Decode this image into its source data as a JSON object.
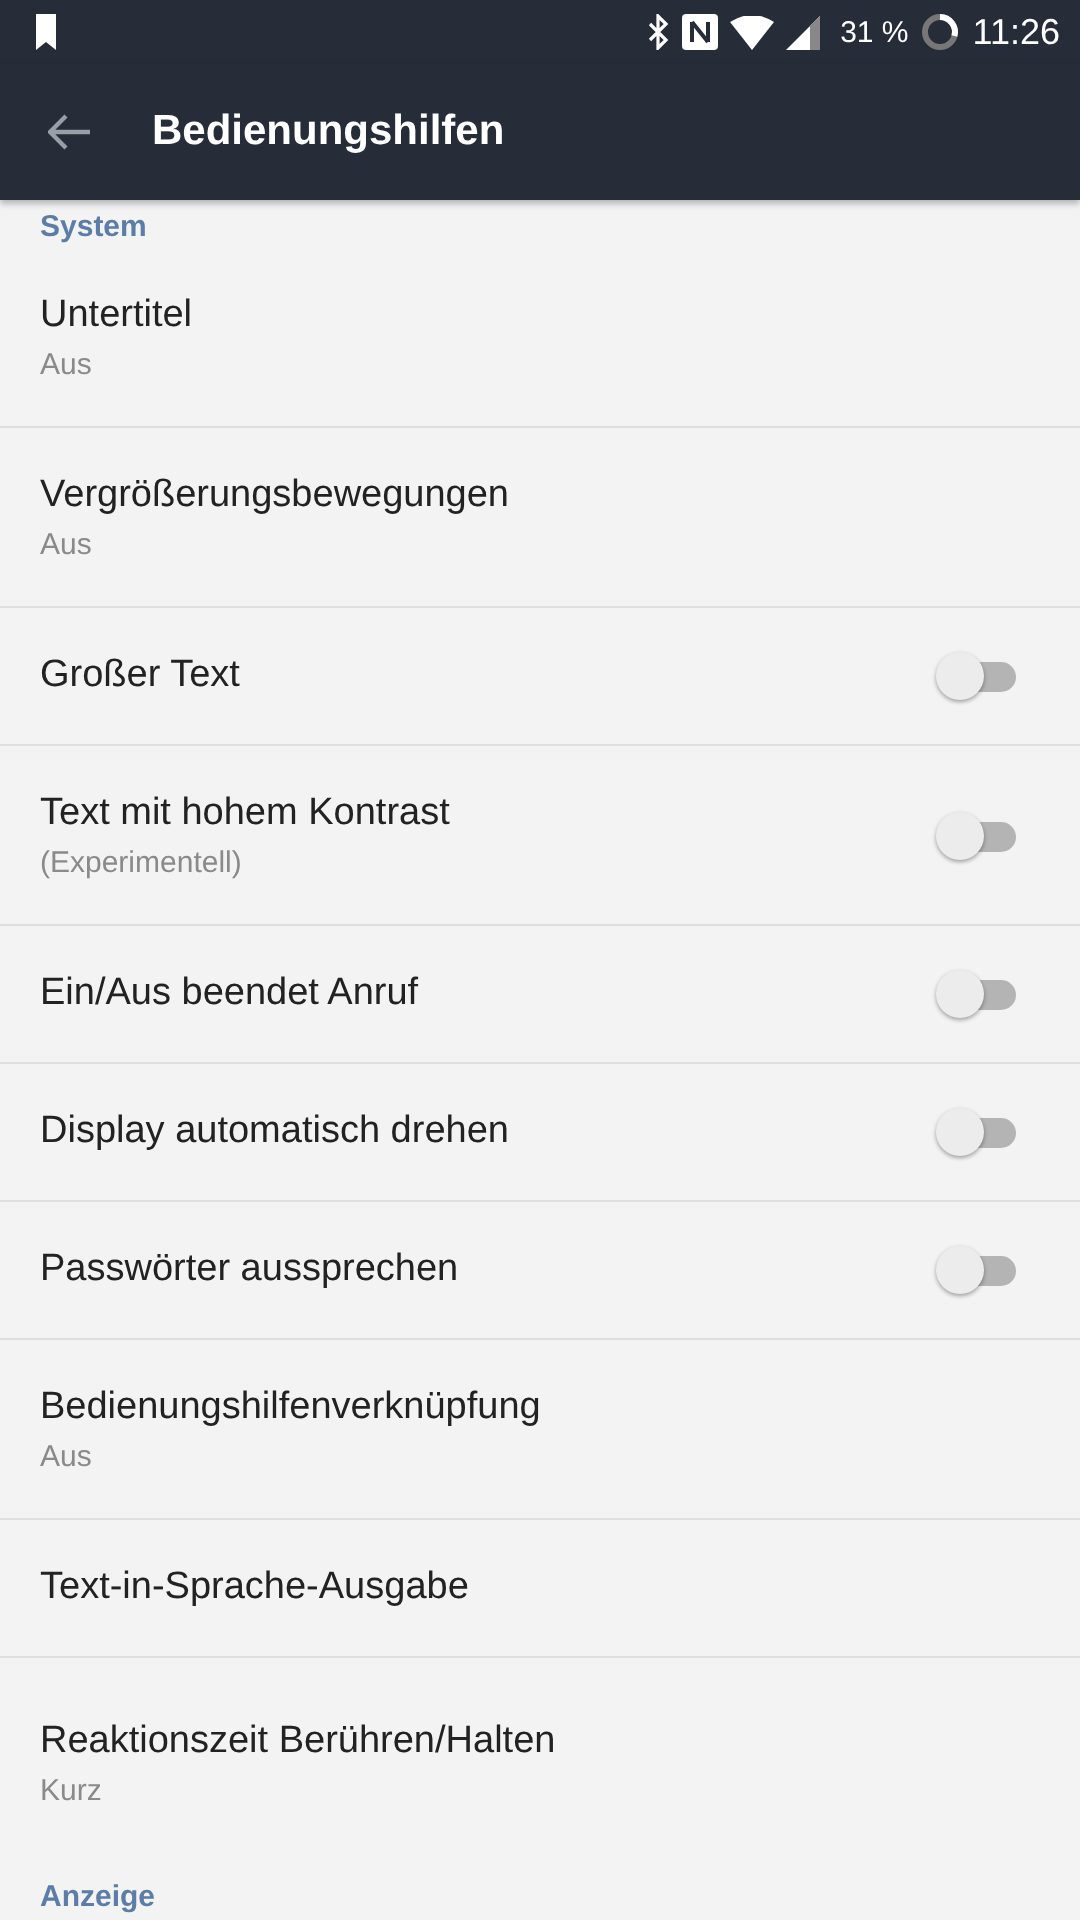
{
  "status_bar": {
    "battery": "31 %",
    "time": "11:26"
  },
  "toolbar": {
    "title": "Bedienungshilfen"
  },
  "sections": [
    {
      "header": "System",
      "items": [
        {
          "kind": "plain",
          "title": "Untertitel",
          "summary": "Aus"
        },
        {
          "kind": "plain",
          "title": "Vergrößerungsbewegungen",
          "summary": "Aus"
        },
        {
          "kind": "toggle",
          "title": "Großer Text",
          "on": false
        },
        {
          "kind": "toggle",
          "title": "Text mit hohem Kontrast",
          "summary": "(Experimentell)",
          "on": false
        },
        {
          "kind": "toggle",
          "title": "Ein/Aus beendet Anruf",
          "on": false
        },
        {
          "kind": "toggle",
          "title": "Display automatisch drehen",
          "on": false
        },
        {
          "kind": "toggle",
          "title": "Passwörter aussprechen",
          "on": false
        },
        {
          "kind": "plain",
          "title": "Bedienungshilfenverknüpfung",
          "summary": "Aus"
        },
        {
          "kind": "plain",
          "title": "Text-in-Sprache-Ausgabe"
        },
        {
          "kind": "plain",
          "title": "Reaktionszeit Berühren/Halten",
          "summary": "Kurz"
        }
      ]
    },
    {
      "header": "Anzeige"
    }
  ]
}
